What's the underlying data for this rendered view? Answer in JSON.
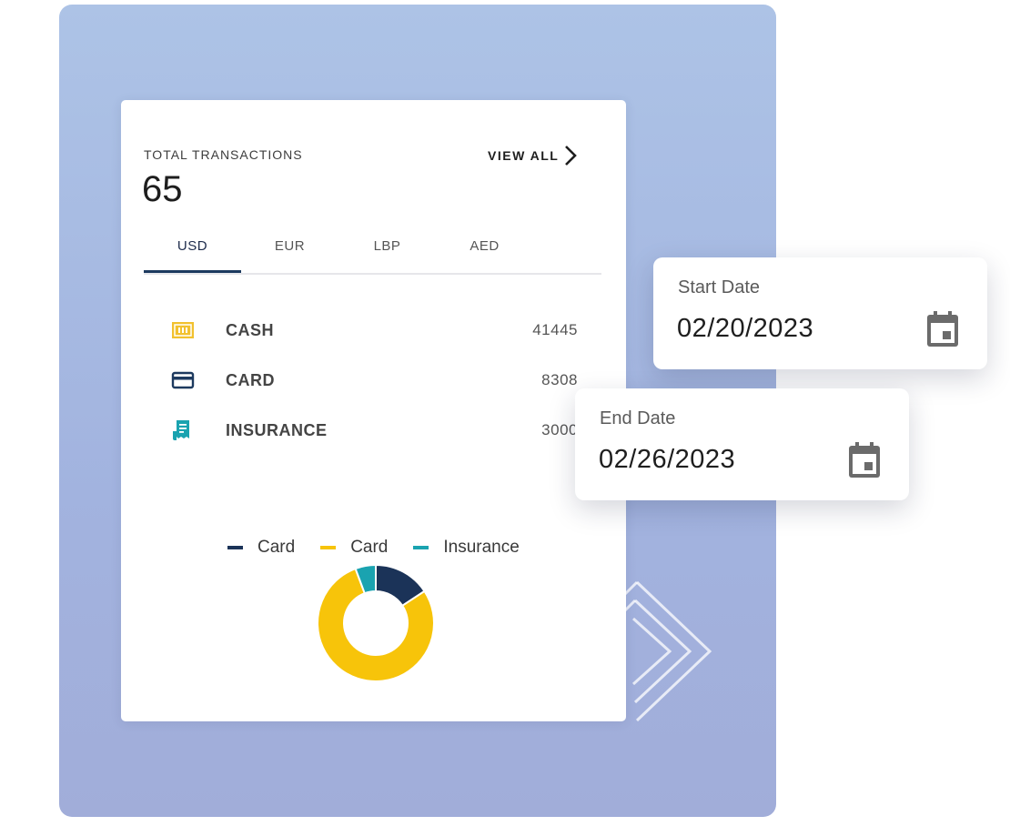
{
  "summary": {
    "label": "TOTAL TRANSACTIONS",
    "count": "65",
    "view_all": "VIEW ALL"
  },
  "tabs": [
    {
      "label": "USD",
      "active": true
    },
    {
      "label": "EUR",
      "active": false
    },
    {
      "label": "LBP",
      "active": false
    },
    {
      "label": "AED",
      "active": false
    }
  ],
  "rows": [
    {
      "name": "CASH",
      "value": "41445",
      "icon": "cash-icon",
      "color": "#f2c12e"
    },
    {
      "name": "CARD",
      "value": "8308",
      "icon": "credit-card-icon",
      "color": "#1d3a5f"
    },
    {
      "name": "INSURANCE",
      "value": "3000",
      "icon": "receipt-icon",
      "color": "#1aa3b0"
    }
  ],
  "chart_data": {
    "type": "pie",
    "legend": [
      "Card",
      "Card",
      "Insurance"
    ],
    "series": [
      {
        "name": "Card",
        "value": 8308,
        "color": "#1b3358"
      },
      {
        "name": "Card",
        "value": 41445,
        "color": "#f7c40a"
      },
      {
        "name": "Insurance",
        "value": 3000,
        "color": "#1aa3b0"
      }
    ],
    "legend_position": "top"
  },
  "start_date": {
    "label": "Start Date",
    "value": "02/20/2023"
  },
  "end_date": {
    "label": "End Date",
    "value": "02/26/2023"
  },
  "colors": {
    "background_panel": "#a8bbe2",
    "accent": "#1d3a5f",
    "yellow": "#f7c40a",
    "teal": "#1aa3b0"
  }
}
